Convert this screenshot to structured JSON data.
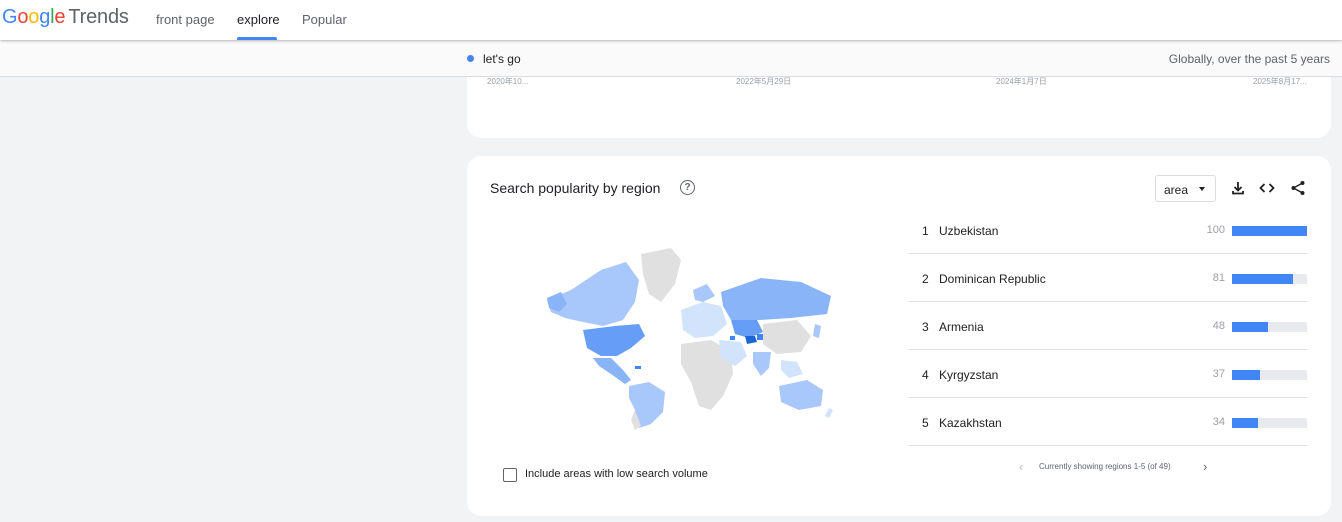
{
  "header": {
    "logo_google": "Google",
    "logo_trends": "Trends",
    "nav": [
      {
        "label": "front page",
        "active": false
      },
      {
        "label": "explore",
        "active": true
      },
      {
        "label": "Popular",
        "active": false
      }
    ]
  },
  "term_bar": {
    "term": "let's go",
    "term_color": "#4285f4",
    "scope": "Globally, over the past 5 years"
  },
  "timeline": {
    "date_labels": [
      "2020年10...",
      "2022年5月29日",
      "2024年1月7日",
      "2025年8月17..."
    ]
  },
  "region_card": {
    "title": "Search popularity by region",
    "help_icon": "help-icon",
    "resolution_select": "area",
    "tools": [
      "download-icon",
      "embed-icon",
      "share-icon"
    ],
    "low_volume_checkbox_label": "Include areas with low search volume",
    "low_volume_checked": false,
    "accent_color": "#4285f4",
    "regions": [
      {
        "rank": "1",
        "name": "Uzbekistan",
        "value": 100
      },
      {
        "rank": "2",
        "name": "Dominican Republic",
        "value": 81
      },
      {
        "rank": "3",
        "name": "Armenia",
        "value": 48
      },
      {
        "rank": "4",
        "name": "Kyrgyzstan",
        "value": 37
      },
      {
        "rank": "5",
        "name": "Kazakhstan",
        "value": 34
      }
    ],
    "pager_text": "Currently showing regions 1-5 (of 49)"
  }
}
